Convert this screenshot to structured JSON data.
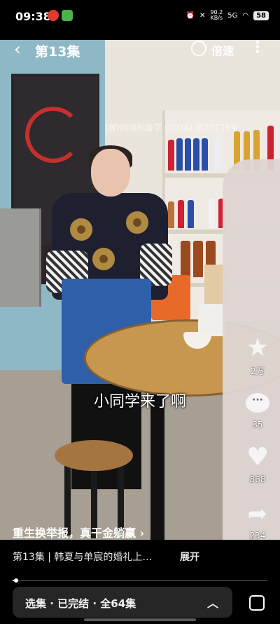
{
  "status_bar": {
    "time": "09:38",
    "net_speed_value": "90.2",
    "net_speed_unit": "KB/s",
    "signal": "5G",
    "battery": "58"
  },
  "player": {
    "back_label": "‹",
    "episode_title": "第13集",
    "speed_label": "倍速",
    "more_label": "⋮",
    "watermark": "(冀)网微剧备字 (2026) 第20275号",
    "subtitle": "小同学来了啊"
  },
  "actions": {
    "favorite_count": "2万",
    "comment_count": "35",
    "like_count": "868",
    "share_count": "234"
  },
  "promo": {
    "text": "重生换举报，真干金躺赢 ›"
  },
  "info": {
    "text": "第13集 | 韩夏与单宸的婚礼上…",
    "expand_label": "展开"
  },
  "progress": {
    "fraction": 0.015
  },
  "series": {
    "label": "选集 · 已完结 · 全64集",
    "chevron": "︿"
  }
}
